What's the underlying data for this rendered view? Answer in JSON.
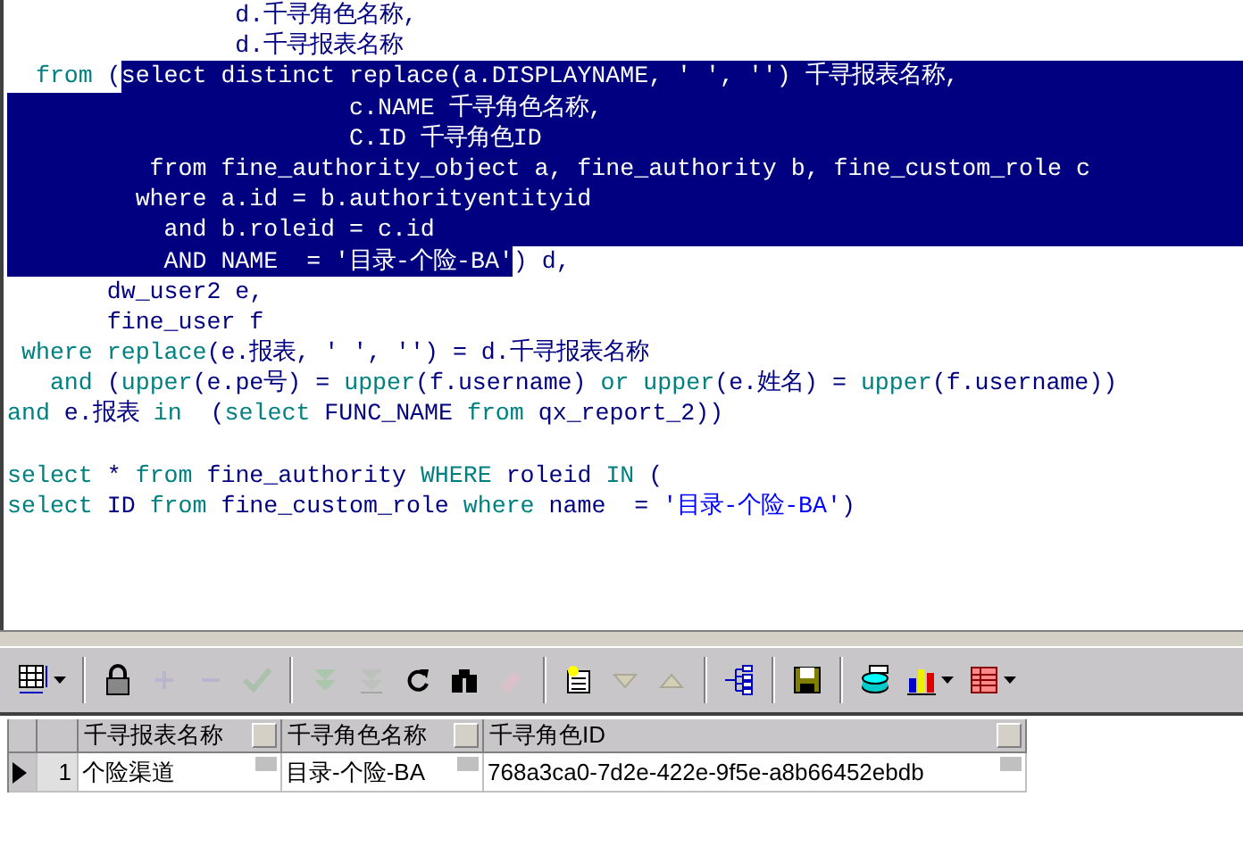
{
  "editor": {
    "lines": [
      {
        "segments": [
          {
            "text": "                d.千寻角色名称,",
            "kind": "ident"
          }
        ],
        "selected_to_end": false
      },
      {
        "segments": [
          {
            "text": "                d.千寻报表名称",
            "kind": "ident"
          }
        ],
        "selected_to_end": false
      },
      {
        "segments": [
          {
            "text": "  from",
            "kind": "keyword"
          },
          {
            "text": " (",
            "kind": "ident"
          },
          {
            "text": "select distinct replace(a.DISPLAYNAME, ' ', '') 千寻报表名称,",
            "kind": "selection"
          }
        ],
        "selected_to_end": true
      },
      {
        "segments": [
          {
            "text": "                        c.NAME 千寻角色名称,",
            "kind": "selection"
          }
        ],
        "selected_to_end": true
      },
      {
        "segments": [
          {
            "text": "                        C.ID 千寻角色ID",
            "kind": "selection"
          }
        ],
        "selected_to_end": true
      },
      {
        "segments": [
          {
            "text": "          from fine_authority_object a, fine_authority b, fine_custom_role c",
            "kind": "selection"
          }
        ],
        "selected_to_end": true
      },
      {
        "segments": [
          {
            "text": "         where a.id = b.authorityentityid",
            "kind": "selection"
          }
        ],
        "selected_to_end": true
      },
      {
        "segments": [
          {
            "text": "           and b.roleid = c.id",
            "kind": "selection"
          }
        ],
        "selected_to_end": true
      },
      {
        "segments": [
          {
            "text": "           AND NAME  = '目录-个险-BA'",
            "kind": "selection"
          },
          {
            "text": ") d,",
            "kind": "ident"
          }
        ],
        "selected_to_end": false
      },
      {
        "segments": [
          {
            "text": "       dw_user2 e,",
            "kind": "ident"
          }
        ],
        "selected_to_end": false
      },
      {
        "segments": [
          {
            "text": "       fine_user f",
            "kind": "ident"
          }
        ],
        "selected_to_end": false
      },
      {
        "segments": [
          {
            "text": " where",
            "kind": "keyword"
          },
          {
            "text": " replace",
            "kind": "keyword"
          },
          {
            "text": "(e.报表, ' ', '') = d.千寻报表名称",
            "kind": "ident"
          }
        ],
        "selected_to_end": false
      },
      {
        "segments": [
          {
            "text": "   and",
            "kind": "keyword"
          },
          {
            "text": " (",
            "kind": "ident"
          },
          {
            "text": "upper",
            "kind": "keyword"
          },
          {
            "text": "(e.pe号) = ",
            "kind": "ident"
          },
          {
            "text": "upper",
            "kind": "keyword"
          },
          {
            "text": "(f.username) ",
            "kind": "ident"
          },
          {
            "text": "or",
            "kind": "keyword"
          },
          {
            "text": " upper",
            "kind": "keyword"
          },
          {
            "text": "(e.姓名) = ",
            "kind": "ident"
          },
          {
            "text": "upper",
            "kind": "keyword"
          },
          {
            "text": "(f.username))",
            "kind": "ident"
          }
        ],
        "selected_to_end": false
      },
      {
        "segments": [
          {
            "text": "and",
            "kind": "keyword"
          },
          {
            "text": " e.报表 ",
            "kind": "ident"
          },
          {
            "text": "in",
            "kind": "keyword"
          },
          {
            "text": "  (",
            "kind": "ident"
          },
          {
            "text": "select",
            "kind": "keyword"
          },
          {
            "text": " FUNC_NAME ",
            "kind": "ident"
          },
          {
            "text": "from",
            "kind": "keyword"
          },
          {
            "text": " qx_report_2))",
            "kind": "ident"
          }
        ],
        "selected_to_end": false
      },
      {
        "kind": "blank"
      },
      {
        "segments": [
          {
            "text": "select",
            "kind": "keyword"
          },
          {
            "text": " * ",
            "kind": "ident"
          },
          {
            "text": "from",
            "kind": "keyword"
          },
          {
            "text": " fine_authority ",
            "kind": "ident"
          },
          {
            "text": "WHERE",
            "kind": "keyword"
          },
          {
            "text": " roleid ",
            "kind": "ident"
          },
          {
            "text": "IN",
            "kind": "keyword"
          },
          {
            "text": " (",
            "kind": "ident"
          }
        ],
        "selected_to_end": false
      },
      {
        "segments": [
          {
            "text": "select",
            "kind": "keyword"
          },
          {
            "text": " ID ",
            "kind": "ident"
          },
          {
            "text": "from",
            "kind": "keyword"
          },
          {
            "text": " fine_custom_role ",
            "kind": "ident"
          },
          {
            "text": "where",
            "kind": "keyword"
          },
          {
            "text": " name  = ",
            "kind": "ident"
          },
          {
            "text": "'目录-个险-BA'",
            "kind": "string"
          },
          {
            "text": ")",
            "kind": "ident"
          }
        ],
        "selected_to_end": false
      }
    ]
  },
  "toolbar": [
    {
      "kind": "grid",
      "disabled": false,
      "dropdown": true
    },
    {
      "kind": "separator"
    },
    {
      "kind": "lock",
      "disabled": false,
      "dropdown": false
    },
    {
      "kind": "add",
      "disabled": true,
      "dropdown": false
    },
    {
      "kind": "remove",
      "disabled": true,
      "dropdown": false
    },
    {
      "kind": "post",
      "disabled": true,
      "dropdown": false
    },
    {
      "kind": "separator"
    },
    {
      "kind": "next",
      "disabled": true,
      "dropdown": false
    },
    {
      "kind": "last",
      "disabled": true,
      "dropdown": false
    },
    {
      "kind": "refresh",
      "disabled": false,
      "dropdown": false
    },
    {
      "kind": "find",
      "disabled": false,
      "dropdown": false
    },
    {
      "kind": "clear",
      "disabled": true,
      "dropdown": false
    },
    {
      "kind": "separator"
    },
    {
      "kind": "notes",
      "disabled": false,
      "dropdown": false
    },
    {
      "kind": "down",
      "disabled": true,
      "dropdown": false
    },
    {
      "kind": "up",
      "disabled": true,
      "dropdown": false
    },
    {
      "kind": "separator"
    },
    {
      "kind": "tree",
      "disabled": false,
      "dropdown": false
    },
    {
      "kind": "separator"
    },
    {
      "kind": "save",
      "disabled": false,
      "dropdown": false
    },
    {
      "kind": "separator"
    },
    {
      "kind": "print",
      "disabled": false,
      "dropdown": false
    },
    {
      "kind": "chart",
      "disabled": false,
      "dropdown": true
    },
    {
      "kind": "table",
      "disabled": false,
      "dropdown": true
    }
  ],
  "grid": {
    "columns": [
      {
        "label": "千寻报表名称"
      },
      {
        "label": "千寻角色名称"
      },
      {
        "label": "千寻角色ID"
      }
    ],
    "rows": [
      {
        "number": "1",
        "selected": true,
        "cells": [
          "个险渠道",
          "目录-个险-BA",
          "768a3ca0-7d2e-422e-9f5e-a8b66452ebdb"
        ]
      }
    ]
  }
}
